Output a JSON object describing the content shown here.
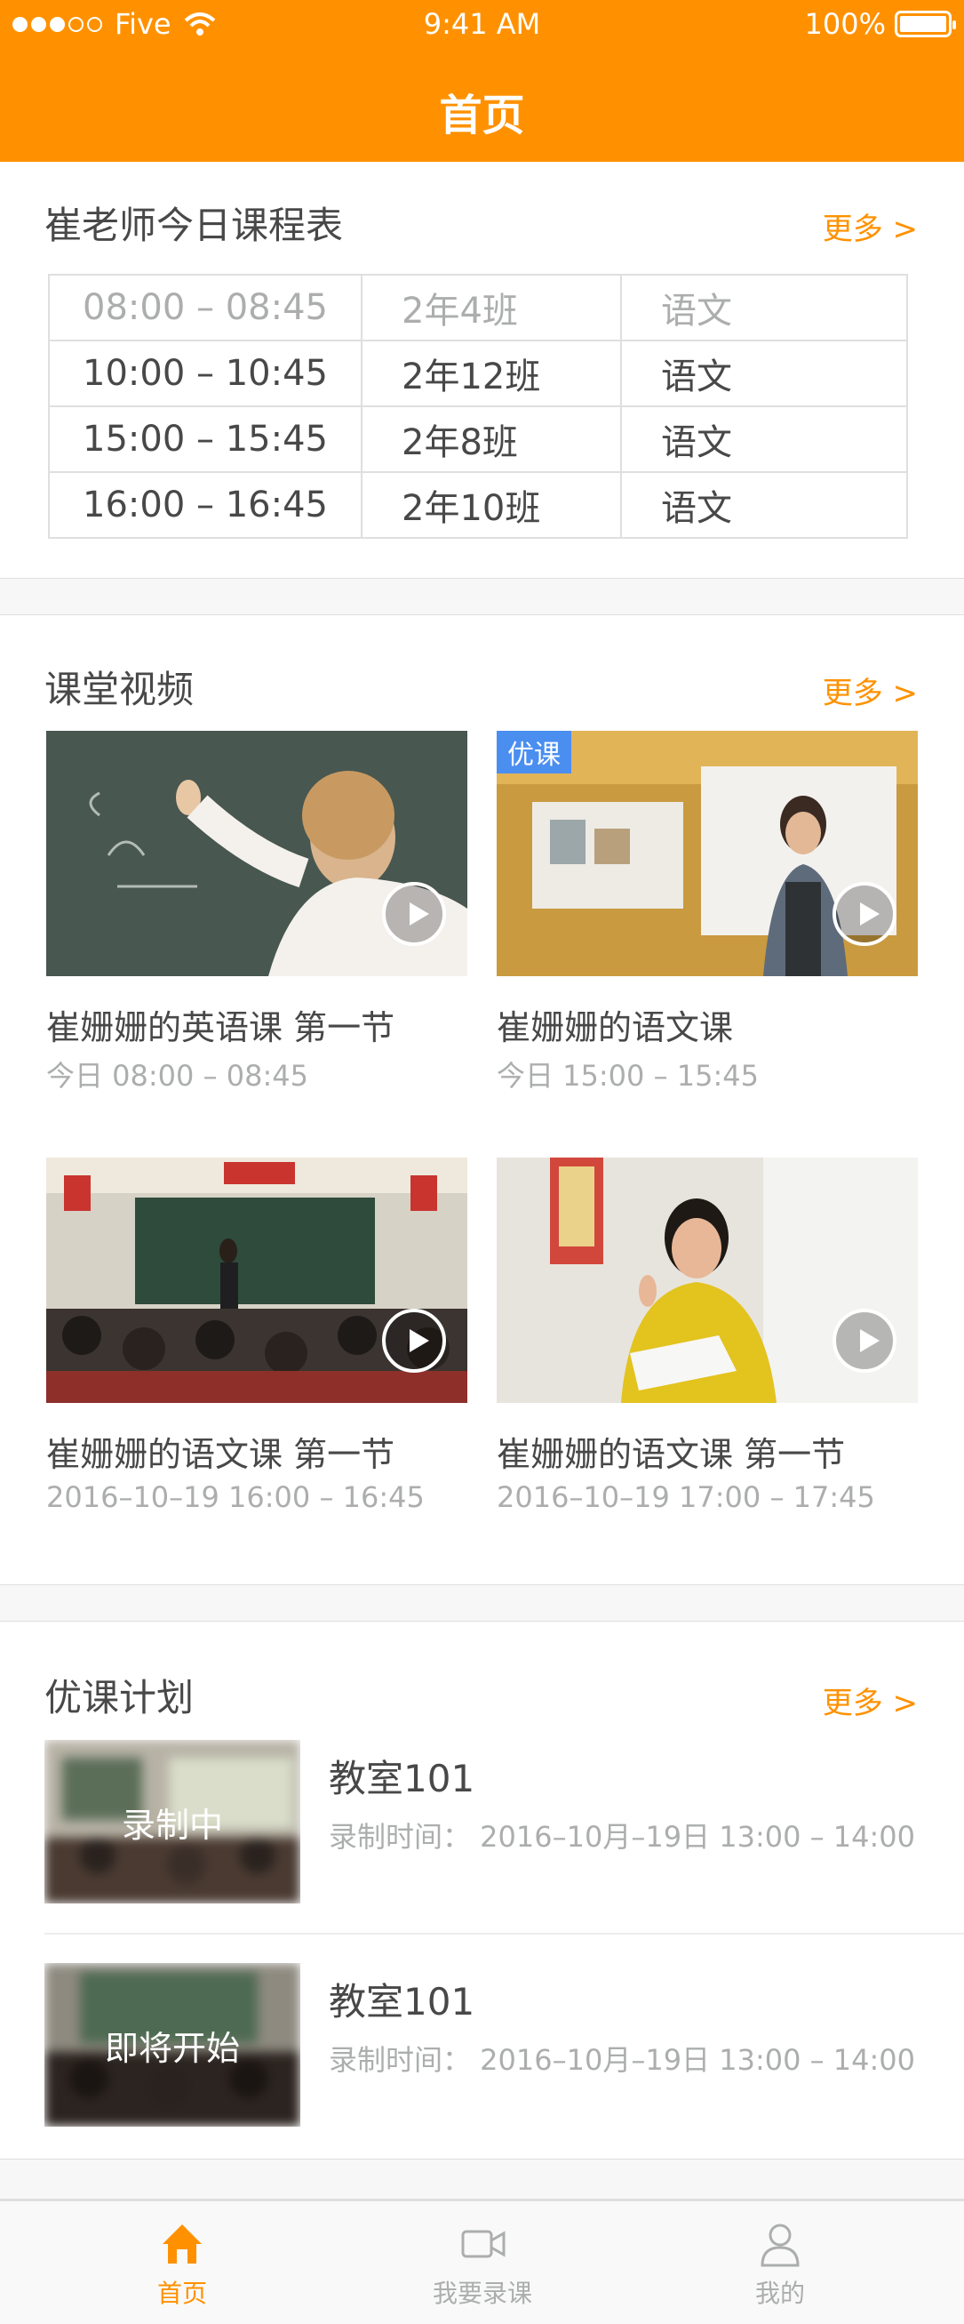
{
  "status_bar": {
    "carrier": "Five",
    "time": "9:41 AM",
    "battery": "100%"
  },
  "nav": {
    "title": "首页"
  },
  "schedule": {
    "title": "崔老师今日课程表",
    "more": "更多 >",
    "rows": [
      {
        "time": "08:00 – 08:45",
        "class": "2年4班",
        "subject": "语文",
        "past": true
      },
      {
        "time": "10:00 – 10:45",
        "class": "2年12班",
        "subject": "语文",
        "past": false
      },
      {
        "time": "15:00 – 15:45",
        "class": "2年8班",
        "subject": "语文",
        "past": false
      },
      {
        "time": "16:00 – 16:45",
        "class": "2年10班",
        "subject": "语文",
        "past": false
      }
    ]
  },
  "videos": {
    "title": "课堂视频",
    "more": "更多 >",
    "items": [
      {
        "title": "崔姗姗的英语课  第一节",
        "time": "今日 08:00 – 08:45",
        "badge": ""
      },
      {
        "title": "崔姗姗的语文课",
        "time": "今日 15:00 – 15:45",
        "badge": "优课"
      },
      {
        "title": "崔姗姗的语文课  第一节",
        "time": "2016–10–19   16:00 – 16:45",
        "badge": ""
      },
      {
        "title": "崔姗姗的语文课  第一节",
        "time": "2016–10–19   17:00 – 17:45",
        "badge": ""
      }
    ]
  },
  "plans": {
    "title": "优课计划",
    "more": "更多 >",
    "items": [
      {
        "status": "录制中",
        "room": "教室101",
        "time": "录制时间：  2016–10月–19日   13:00 – 14:00"
      },
      {
        "status": "即将开始",
        "room": "教室101",
        "time": "录制时间：  2016–10月–19日   13:00 – 14:00"
      }
    ]
  },
  "tabs": [
    {
      "label": "首页",
      "icon": "home-icon",
      "active": true
    },
    {
      "label": "我要录课",
      "icon": "video-camera-icon",
      "active": false
    },
    {
      "label": "我的",
      "icon": "user-icon",
      "active": false
    }
  ],
  "colors": {
    "accent": "#FF9100",
    "text": "#484848",
    "muted": "#ACAEAE",
    "divider": "#DFDFDF",
    "gap": "#F7F7F7",
    "badge": "#4A8EF0"
  }
}
